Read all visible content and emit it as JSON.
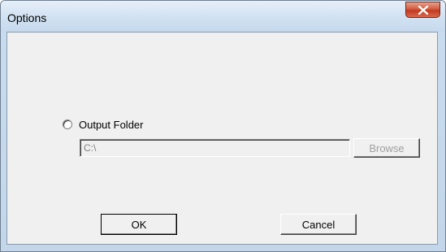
{
  "window": {
    "title": "Options",
    "close_icon": "close-icon"
  },
  "output": {
    "radio_label": "Output Folder",
    "radio_selected": false,
    "path_value": "C:\\",
    "browse_label": "Browse",
    "browse_enabled": false
  },
  "buttons": {
    "ok_label": "OK",
    "cancel_label": "Cancel"
  },
  "colors": {
    "close_button": "#c83f24",
    "disabled_text": "#a0a0a0"
  }
}
